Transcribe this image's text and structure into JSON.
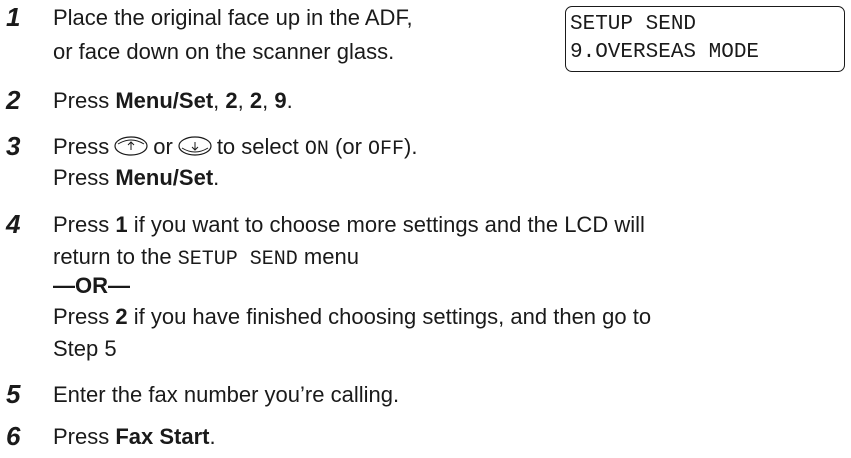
{
  "steps": [
    {
      "num": "1",
      "line1": "Place the original face up in the ADF,",
      "line2": "or face down on the scanner glass."
    },
    {
      "num": "2",
      "prefix": "Press ",
      "menu_set": "Menu/Set",
      "sep1": ", ",
      "k1": "2",
      "sep2": ", ",
      "k2": "2",
      "sep3": ", ",
      "k3": "9",
      "suffix": "."
    },
    {
      "num": "3",
      "prefix": "Press",
      "or_word": "or",
      "select_text": "to select",
      "on_value": "ON",
      "or_paren": "(or",
      "off_value": "OFF",
      "close_paren": ").",
      "line2_prefix": "Press ",
      "line2_bold": "Menu/Set",
      "line2_suffix": "."
    },
    {
      "num": "4",
      "l1_prefix": "Press ",
      "l1_bold": "1",
      "l1_rest": " if you want to choose more settings and the LCD will",
      "l2_prefix": "return to the ",
      "l2_mono": "SETUP SEND",
      "l2_suffix": " menu",
      "or_line": "—OR—",
      "l4_prefix": "Press ",
      "l4_bold": "2",
      "l4_rest": " if you have finished choosing settings, and then go to",
      "l5": "Step 5"
    },
    {
      "num": "5",
      "text": "Enter the fax number you’re calling."
    },
    {
      "num": "6",
      "prefix": "Press ",
      "bold": "Fax Start",
      "suffix": "."
    }
  ],
  "lcd": {
    "line1": "SETUP SEND",
    "line2": "9.OVERSEAS MODE"
  },
  "icons": {
    "up_arrow": "up-arrow-key-icon",
    "down_arrow": "down-arrow-key-icon"
  }
}
